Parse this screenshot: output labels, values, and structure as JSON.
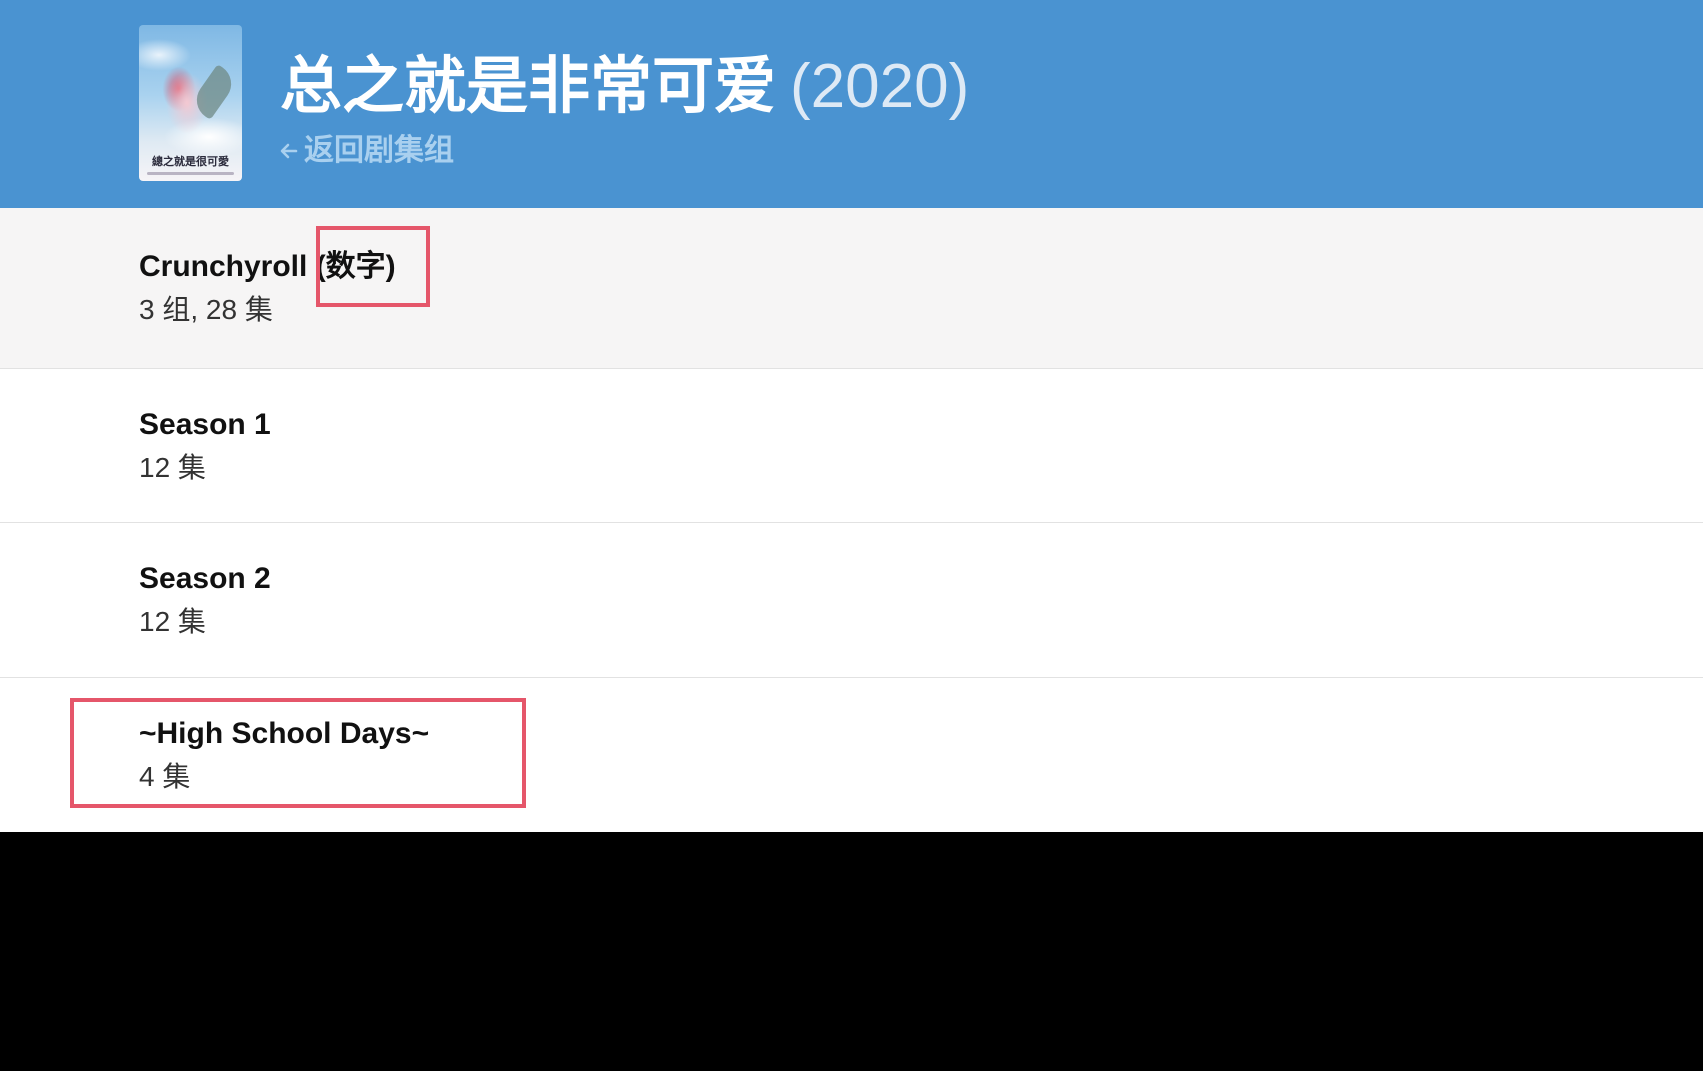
{
  "header": {
    "title": "总之就是非常可爱",
    "year": "(2020)",
    "back_label": "返回剧集组",
    "back_icon": "arrow-left-icon",
    "poster_text": "總之就是很可愛",
    "background_color": "#4a93d1"
  },
  "groups": [
    {
      "title": "Crunchyroll (数字)",
      "count": "3 组, 28 集"
    },
    {
      "title": "Season 1",
      "count": "12 集"
    },
    {
      "title": "Season 2",
      "count": "12 集"
    },
    {
      "title": "~High School Days~",
      "count": "4 集"
    }
  ],
  "highlight_color": "#e5566a"
}
